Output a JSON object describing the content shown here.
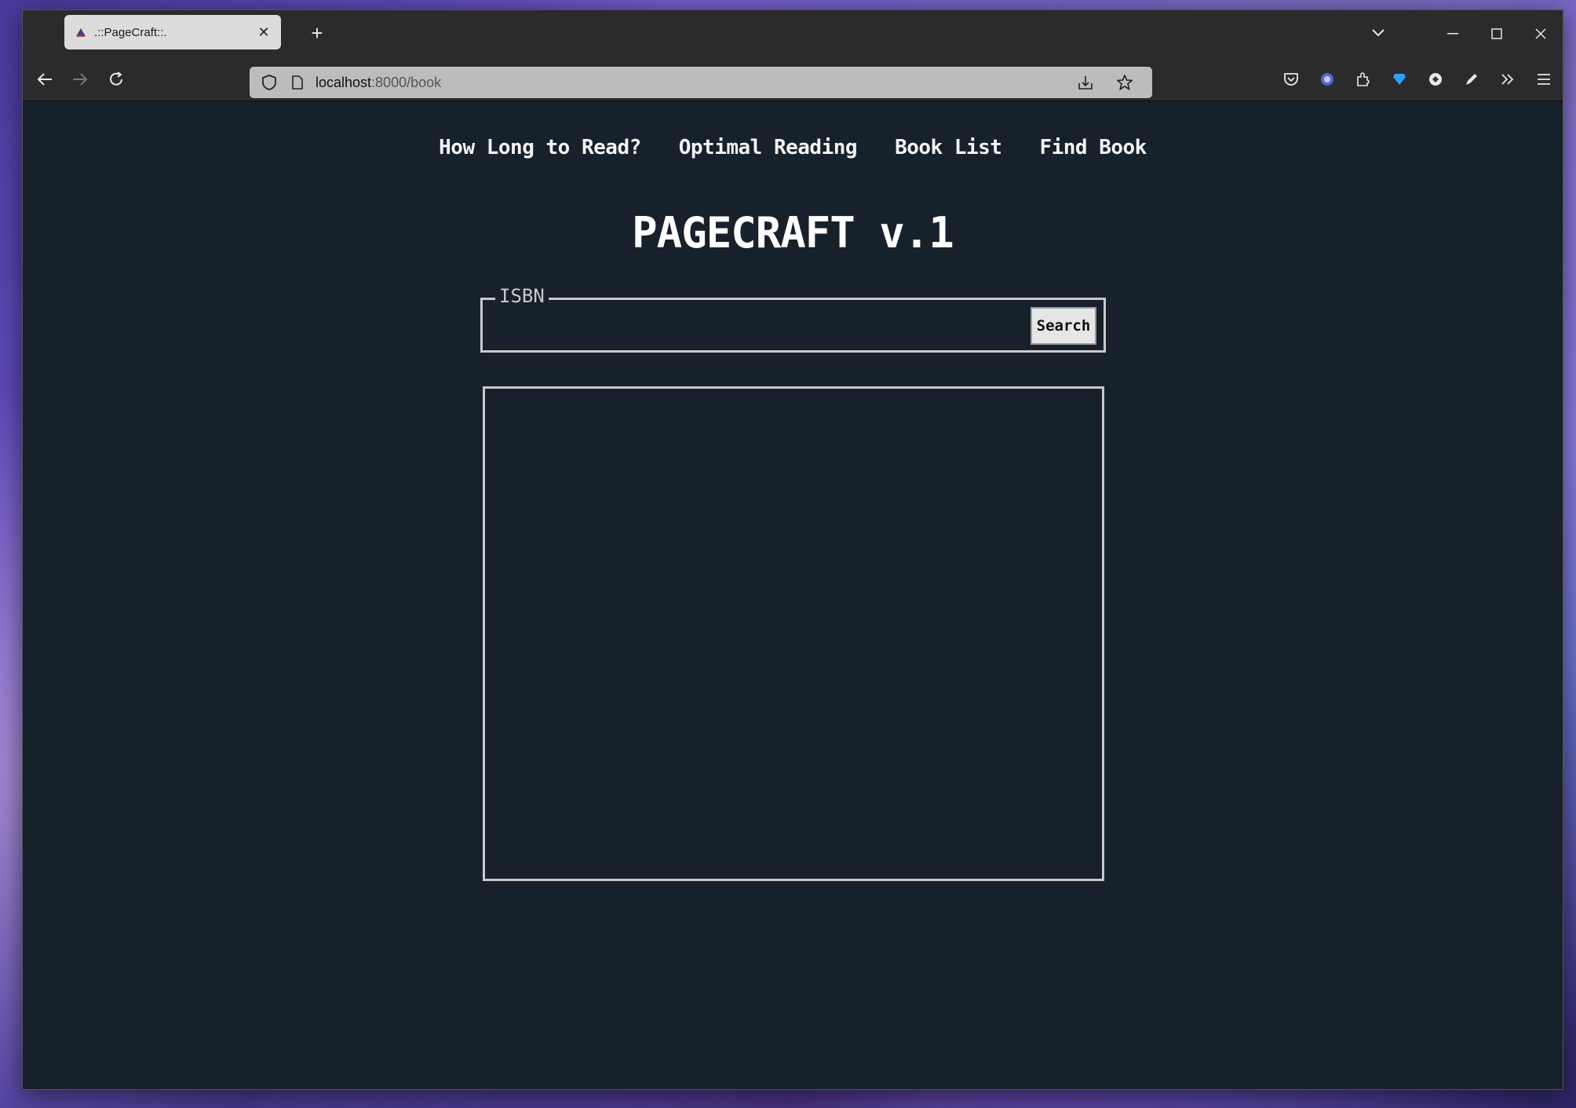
{
  "browser": {
    "tab": {
      "title": ".::PageCraft::."
    },
    "url": {
      "host": "localhost",
      "rest": ":8000/book"
    }
  },
  "site": {
    "nav": [
      {
        "label": "How Long to Read?"
      },
      {
        "label": "Optimal Reading"
      },
      {
        "label": "Book List"
      },
      {
        "label": "Find Book"
      }
    ],
    "title": "PAGECRAFT v.1",
    "isbn": {
      "legend": "ISBN",
      "value": "",
      "button_label": "Search"
    }
  }
}
